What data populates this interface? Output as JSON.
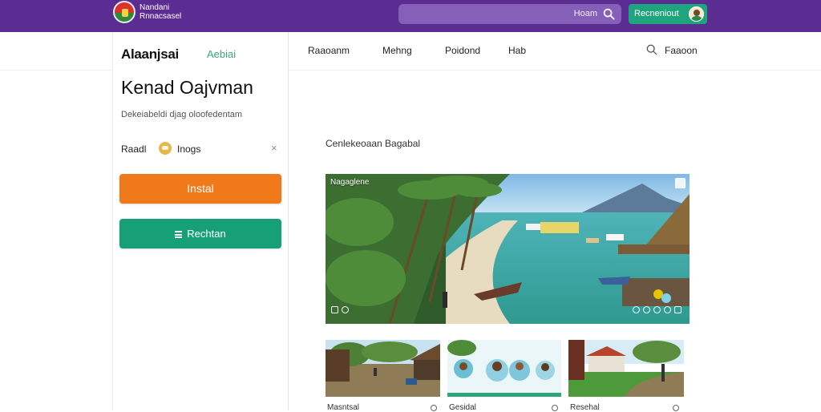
{
  "topbar": {
    "brand_line1": "Nandani",
    "brand_line2": "Rnnacsasel",
    "search_placeholder": "Hoam",
    "action_label": "Recneniout"
  },
  "sidebar": {
    "brand": "Alaanjsai",
    "brand_sub": "Aebiai",
    "title": "Kenad Oajvman",
    "description": "Dekeiabeldi djag oloofedentam",
    "tag_label": "Raadl",
    "tag_text": "Inogs",
    "tag_close": "×",
    "install_label": "Instal",
    "secondary_label": "Rechtan"
  },
  "nav": {
    "items": [
      "Raaoanm",
      "Mehng",
      "Poidond",
      "Hab"
    ],
    "search_label": "Faaoon"
  },
  "main": {
    "section_title": "Cenlekeoaan Bagabal",
    "hero_caption": "Nagaglene",
    "thumbs": [
      {
        "label": "Masntsal"
      },
      {
        "label": "Gesidal"
      },
      {
        "label": "Resehal"
      }
    ]
  },
  "colors": {
    "topbar": "#5b2c91",
    "install": "#f07a1a",
    "secondary": "#17a077",
    "action": "#1fa57d"
  }
}
